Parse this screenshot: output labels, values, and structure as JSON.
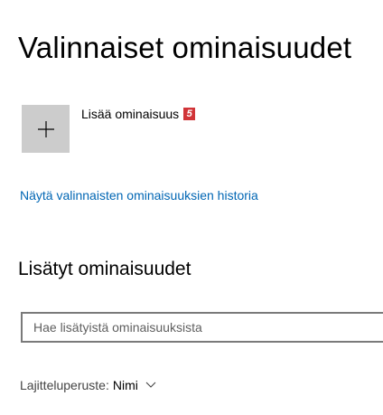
{
  "page": {
    "title": "Valinnaiset ominaisuudet"
  },
  "add_feature": {
    "label": "Lisää ominaisuus",
    "badge": "5",
    "icon": "plus-icon"
  },
  "history_link": {
    "label": "Näytä valinnaisten ominaisuuksien historia"
  },
  "installed": {
    "heading": "Lisätyt ominaisuudet",
    "search_placeholder": "Hae lisätyistä ominaisuuksista",
    "sort_prefix": "Lajitteluperuste:",
    "sort_value": "Nimi",
    "sort_icon": "chevron-down-icon"
  },
  "colors": {
    "link": "#0066b4",
    "badge": "#d13438",
    "add_button_bg": "#cccccc"
  }
}
